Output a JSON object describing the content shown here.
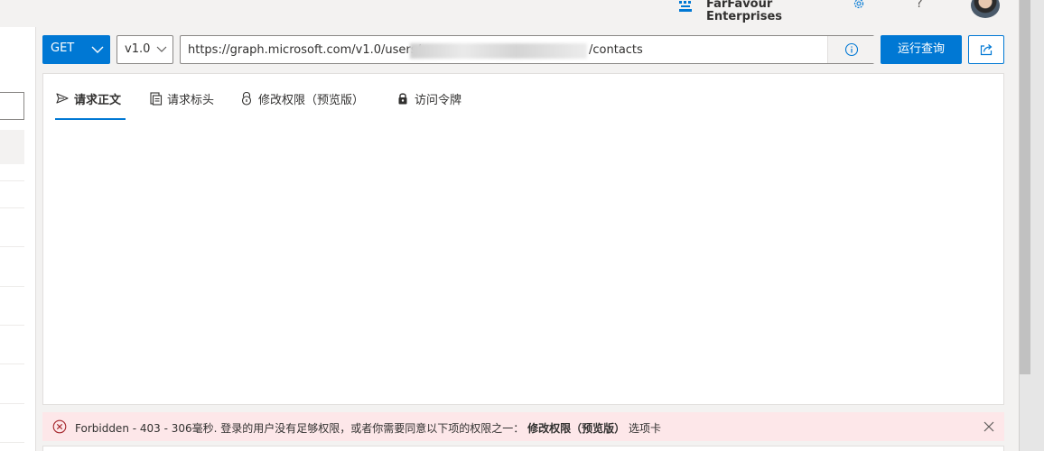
{
  "header": {
    "org_line1": "FarFavour",
    "org_line2": "Enterprises",
    "help_glyph": "?"
  },
  "request": {
    "method": "GET",
    "version": "v1.0",
    "url_prefix": "https://graph.microsoft.com/v1.0/users/",
    "url_suffix": "/contacts",
    "run_label": "运行查询"
  },
  "tabs": [
    {
      "label": "请求正文",
      "icon": "send-icon",
      "active": true
    },
    {
      "label": "请求标头",
      "icon": "document-icon",
      "active": false
    },
    {
      "label": "修改权限（预览版）",
      "icon": "shield-lock-icon",
      "active": false
    },
    {
      "label": "访问令牌",
      "icon": "lock-icon",
      "active": false
    }
  ],
  "error": {
    "message": "Forbidden - 403 - 306毫秒. 登录的用户没有足够权限，或者你需要同意以下项的权限之一：",
    "emphasis": "修改权限（预览版）",
    "trailing": "选项卡"
  },
  "colors": {
    "accent": "#0078d4",
    "error_background": "#fde7e9",
    "error_icon": "#a4262c"
  }
}
